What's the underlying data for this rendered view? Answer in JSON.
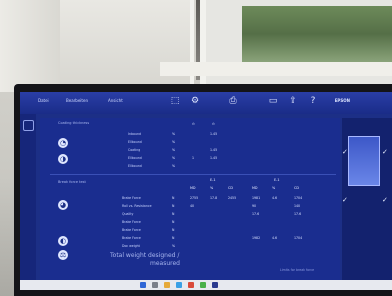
{
  "toolbar": {
    "items": [
      "Datei",
      "Bearbeiten",
      "Ansicht"
    ],
    "brand": "EPSON"
  },
  "section1": {
    "title": "Coating thickness",
    "rows": [
      {
        "label": "Inbound",
        "unit": "%",
        "v1": "",
        "v2": "1.45"
      },
      {
        "label": "Ellbound",
        "unit": "%",
        "v1": "",
        "v2": ""
      },
      {
        "label": "Coating",
        "unit": "%",
        "v1": "",
        "v2": "1.45"
      },
      {
        "label": "Ellbound",
        "unit": "%",
        "v1": "1",
        "v2": "1.45"
      },
      {
        "label": "Ellbound",
        "unit": "%",
        "v1": "",
        "v2": ""
      }
    ]
  },
  "section2": {
    "title": "Break force test",
    "group_headers": [
      "E-1",
      "E-1"
    ],
    "col_headers": [
      "MD",
      "%",
      "CD",
      "MD",
      "%",
      "CD"
    ],
    "rows": [
      {
        "label": "Brake Force",
        "unit": "N",
        "cells": [
          "2755",
          "17.8",
          "2455",
          "1981",
          "4.6",
          "1704"
        ]
      },
      {
        "label": "Roll vs. Resistance",
        "unit": "N",
        "cells": [
          "40",
          "",
          "",
          "90",
          "",
          "140"
        ]
      },
      {
        "label": "Quality",
        "unit": "N",
        "cells": [
          "",
          "",
          "",
          "17.6",
          "",
          "17.6"
        ]
      },
      {
        "label": "Brake Force",
        "unit": "N",
        "cells": [
          "",
          "",
          "",
          "",
          "",
          ""
        ]
      },
      {
        "label": "Brake Force",
        "unit": "N",
        "cells": [
          "",
          "",
          "",
          "",
          "",
          ""
        ]
      },
      {
        "label": "Brake Force",
        "unit": "N",
        "cells": [
          "",
          "",
          "",
          "1982",
          "4.6",
          "1704"
        ]
      },
      {
        "label": "Doc weight",
        "unit": "%",
        "cells": [
          "",
          "",
          "",
          "",
          "",
          ""
        ]
      }
    ],
    "total_weight_label": "Total weight designed /",
    "measured_label": "measured",
    "caption": "Limits for break force"
  },
  "colors": {
    "screen_bg": "#1c2f86",
    "accent": "#dfe6ff"
  }
}
